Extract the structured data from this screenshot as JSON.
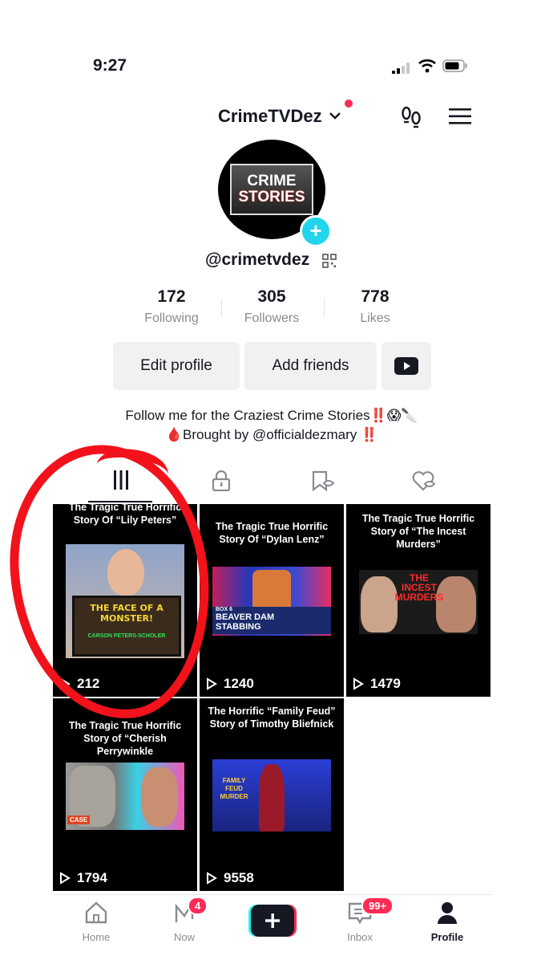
{
  "status": {
    "time": "9:27"
  },
  "header": {
    "username": "CrimeTVDez"
  },
  "profile": {
    "avatar_line1": "CRIME",
    "avatar_line2": "STORIES",
    "handle": "@crimetvdez",
    "stats": [
      {
        "value": "172",
        "label": "Following"
      },
      {
        "value": "305",
        "label": "Followers"
      },
      {
        "value": "778",
        "label": "Likes"
      }
    ],
    "buttons": {
      "edit": "Edit profile",
      "add_friends": "Add friends"
    },
    "bio_line1": "Follow me for the Craziest Crime Stories‼️😱🔪",
    "bio_line2": "🩸Brought by @officialdezmary ‼️"
  },
  "videos": [
    {
      "title": "The Tragic True Horrific Story Of “Lily Peters”",
      "views": "212",
      "thumb_text": "THE FACE OF A MONSTER!",
      "thumb_caption": "CARSON PETERS-SCHOLER"
    },
    {
      "title": "The Tragic True Horrific Story Of “Dylan Lenz”",
      "views": "1240",
      "thumb_text": "BEAVER DAM STABBING",
      "thumb_caption": "BOX 6"
    },
    {
      "title": "The Tragic True Horrific Story of “The Incest Murders”",
      "views": "1479",
      "thumb_text": "THE INCEST MURDERS"
    },
    {
      "title": "The Tragic True Horrific Story of “Cherish Perrywinkle",
      "views": "1794",
      "thumb_text": "CASE"
    },
    {
      "title": "The Horrific “Family Feud” Story of Timothy Bliefnick",
      "views": "9558",
      "thumb_text": "FAMILY FEUD MURDER"
    }
  ],
  "nav": {
    "home": "Home",
    "now": "Now",
    "now_badge": "4",
    "inbox": "Inbox",
    "inbox_badge": "99+",
    "profile": "Profile"
  },
  "colors": {
    "accent": "#fe2c55",
    "cyan": "#20d5ec",
    "annotation": "#f1121b"
  },
  "icons": [
    "signal-icon",
    "wifi-icon",
    "battery-icon",
    "chevron-down-icon",
    "footsteps-icon",
    "menu-icon",
    "plus-icon",
    "qr-code-icon",
    "youtube-icon",
    "grid-icon",
    "lock-icon",
    "bookmark-icon",
    "heart-hidden-icon",
    "play-icon",
    "home-icon",
    "now-icon",
    "create-icon",
    "inbox-icon",
    "profile-icon"
  ]
}
